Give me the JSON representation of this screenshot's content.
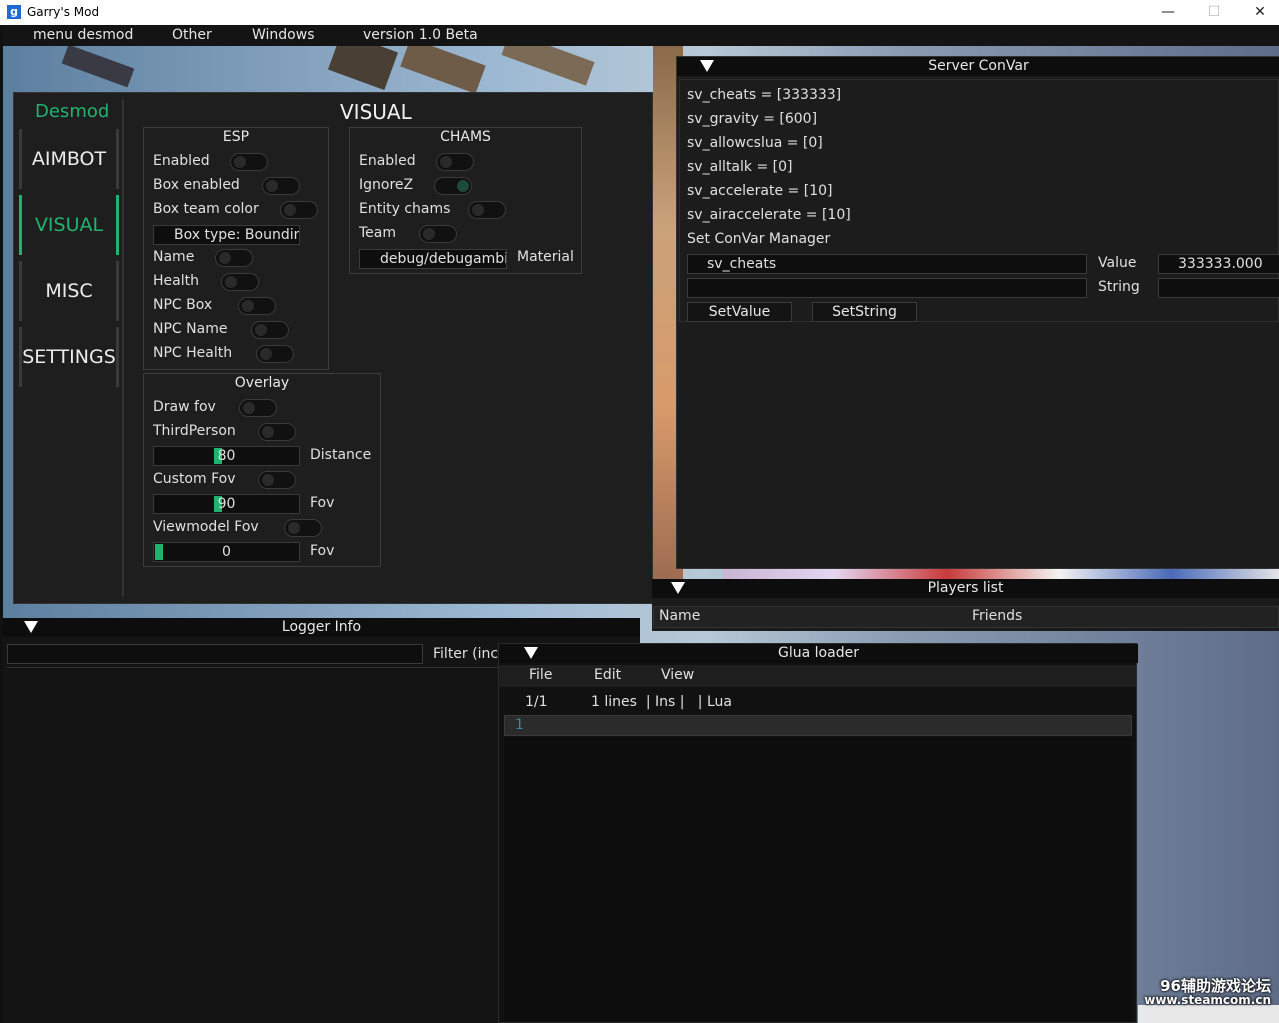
{
  "window": {
    "title": "Garry's Mod",
    "app_icon": "g",
    "controls": {
      "minimize": "—",
      "maximize": "☐",
      "close": "✕"
    }
  },
  "menubar": [
    "menu desmod",
    "Other",
    "Windows",
    "version 1.0 Beta"
  ],
  "desmod": {
    "brand": "Desmod",
    "section_title": "VISUAL",
    "nav": [
      "AIMBOT",
      "VISUAL",
      "MISC",
      "SETTINGS"
    ],
    "accent": "#1fb36e",
    "esp": {
      "title": "ESP",
      "items": [
        "Enabled",
        "Box enabled",
        "Box team color"
      ],
      "box_type": "Box type: Boundin",
      "items2": [
        "Name",
        "Health",
        "NPC Box",
        "NPC Name",
        "NPC Health"
      ]
    },
    "chams": {
      "title": "CHAMS",
      "items": [
        "Enabled",
        "IgnoreZ",
        "Entity chams",
        "Team"
      ],
      "material_value": "debug/debugambi",
      "material_label": "Material"
    },
    "overlay": {
      "title": "Overlay",
      "draw_fov": "Draw fov",
      "third_person": "ThirdPerson",
      "distance_value": "80",
      "distance_label": "Distance",
      "custom_fov": "Custom Fov",
      "fov_value": "90",
      "fov_label": "Fov",
      "viewmodel_fov": "Viewmodel Fov",
      "viewmodel_value": "0",
      "viewmodel_label": "Fov"
    }
  },
  "server_convar": {
    "title": "Server ConVar",
    "lines": [
      "sv_cheats = [333333]",
      "sv_gravity = [600]",
      "sv_allowcslua = [0]",
      "sv_alltalk = [0]",
      "sv_accelerate = [10]",
      "sv_airaccelerate = [10]"
    ],
    "manager_label": "Set ConVar Manager",
    "name_input": "sv_cheats",
    "value_label": "Value",
    "value_input": "333333.000",
    "string_label": "String",
    "setvalue": "SetValue",
    "setstring": "SetString"
  },
  "players_list": {
    "title": "Players list",
    "col_name": "Name",
    "col_friends": "Friends"
  },
  "logger": {
    "title": "Logger Info",
    "filter_label": "Filter (inc."
  },
  "glua": {
    "title": "Glua loader",
    "menu": [
      "File",
      "Edit",
      "View"
    ],
    "status_pos": "1/1",
    "status_info": "1 lines  | Ins |   | Lua",
    "line_number": "1"
  },
  "watermark": {
    "line1": "96辅助游戏论坛",
    "line2": "www.steamcom.cn"
  }
}
